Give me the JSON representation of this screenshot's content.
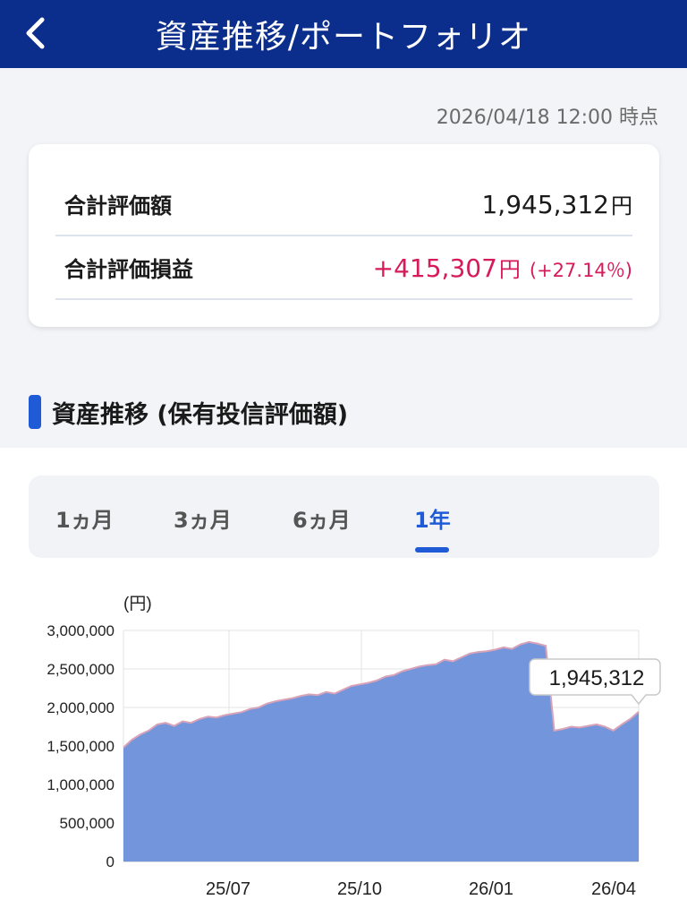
{
  "header": {
    "title": "資産推移/ポートフォリオ",
    "back_icon": "chevron-left-icon"
  },
  "timestamp": "2026/04/18 12:00 時点",
  "summary": {
    "total_value_label": "合計評価額",
    "total_value": "1,945,312",
    "total_value_unit": "円",
    "total_pl_label": "合計評価損益",
    "total_pl": "+415,307",
    "total_pl_unit": "円",
    "total_pl_pct": "(+27.14％)",
    "pl_color": "#d61a5a"
  },
  "section": {
    "title": "資産推移 (保有投信評価額)",
    "accent_color": "#1f5bd6"
  },
  "tabs": [
    {
      "label": "1ヵ月",
      "active": false
    },
    {
      "label": "3ヵ月",
      "active": false
    },
    {
      "label": "6ヵ月",
      "active": false
    },
    {
      "label": "1年",
      "active": true
    }
  ],
  "chart_data": {
    "type": "area",
    "ylabel": "(円)",
    "ylim": [
      0,
      3000000
    ],
    "yticks": [
      "3,000,000",
      "2,500,000",
      "2,000,000",
      "1,500,000",
      "1,000,000",
      "500,000",
      "0"
    ],
    "xticks": [
      "25/07",
      "25/10",
      "26/01",
      "26/04"
    ],
    "tooltip": "1,945,312",
    "fill_color": "#7395db",
    "line_color": "#d8a3b8",
    "series": [
      {
        "values": [
          1480000,
          1580000,
          1650000,
          1700000,
          1780000,
          1800000,
          1760000,
          1820000,
          1800000,
          1850000,
          1880000,
          1870000,
          1900000,
          1920000,
          1940000,
          1980000,
          2000000,
          2050000,
          2080000,
          2100000,
          2120000,
          2150000,
          2170000,
          2160000,
          2200000,
          2180000,
          2230000,
          2280000,
          2300000,
          2320000,
          2350000,
          2400000,
          2420000,
          2470000,
          2500000,
          2530000,
          2550000,
          2560000,
          2620000,
          2600000,
          2650000,
          2700000,
          2720000,
          2730000,
          2750000,
          2780000,
          2760000,
          2820000,
          2850000,
          2830000,
          2800000,
          1700000,
          1720000,
          1750000,
          1740000,
          1760000,
          1780000,
          1750000,
          1700000,
          1780000,
          1850000,
          1945312
        ]
      }
    ]
  }
}
